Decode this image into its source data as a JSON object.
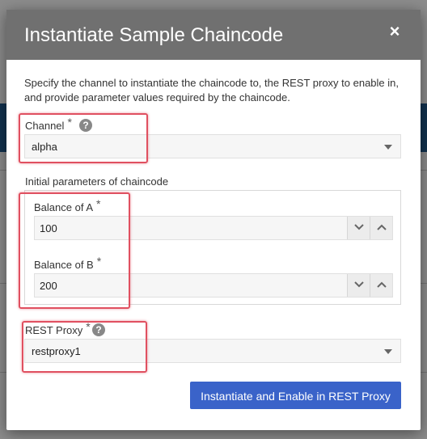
{
  "dialog": {
    "title": "Instantiate Sample Chaincode",
    "close_icon": "×",
    "description": "Specify the channel to instantiate the chaincode to, the REST proxy to enable in, and provide parameter values required by the chaincode."
  },
  "channel": {
    "label": "Channel",
    "required_mark": "*",
    "help_icon": "?",
    "selected": "alpha"
  },
  "params": {
    "legend": "Initial parameters of chaincode",
    "balance_a": {
      "label": "Balance of A",
      "required_mark": "*",
      "value": "100"
    },
    "balance_b": {
      "label": "Balance of B",
      "required_mark": "*",
      "value": "200"
    }
  },
  "rest_proxy": {
    "label": "REST Proxy",
    "required_mark": "*",
    "help_icon": "?",
    "selected": "restproxy1"
  },
  "submit": {
    "label": "Instantiate and Enable in REST Proxy"
  },
  "colors": {
    "header": "#707070",
    "primary_button": "#3a63c9",
    "highlight": "#e05060"
  },
  "icons": [
    "close-icon",
    "help-icon",
    "chevron-down-icon",
    "chevron-up-icon",
    "caret-down-icon"
  ]
}
